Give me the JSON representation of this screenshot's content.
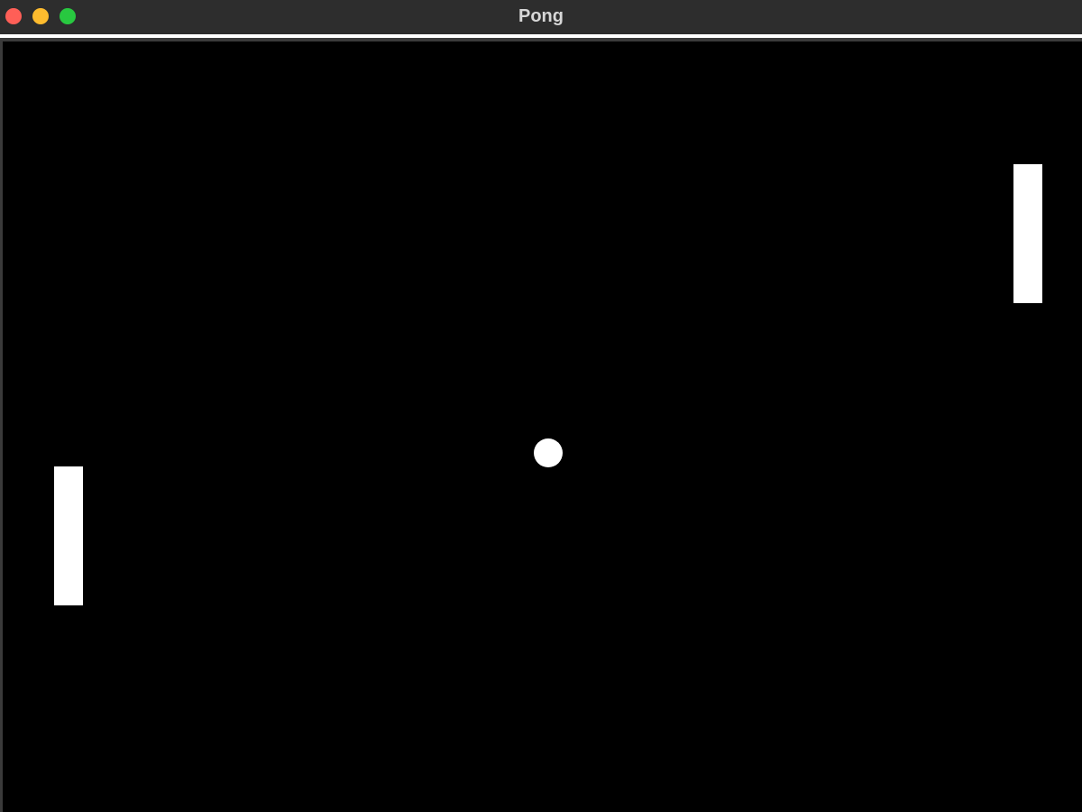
{
  "window": {
    "title": "Pong",
    "controls": [
      {
        "name": "close-button",
        "color": "#ff5f57"
      },
      {
        "name": "minimize-button",
        "color": "#febc2e"
      },
      {
        "name": "zoom-button",
        "color": "#28c840"
      }
    ]
  },
  "game": {
    "background_color": "#000000",
    "paddle_color": "#ffffff",
    "ball_color": "#ffffff",
    "entities": [
      "left-paddle",
      "right-paddle",
      "ball"
    ]
  }
}
